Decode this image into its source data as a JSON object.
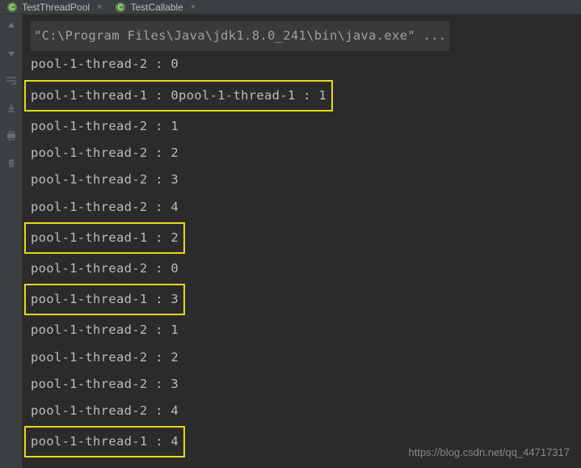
{
  "tabs": [
    {
      "label": "TestThreadPool",
      "active": false
    },
    {
      "label": "TestCallable",
      "active": true
    }
  ],
  "console": {
    "command": "\"C:\\Program Files\\Java\\jdk1.8.0_241\\bin\\java.exe\" ...",
    "lines": [
      {
        "text": "pool-1-thread-2 : 0",
        "highlighted": false
      },
      {
        "text": "pool-1-thread-1 : 0",
        "highlighted": true
      },
      {
        "text": "pool-1-thread-1 : 1",
        "highlighted": true,
        "grouped": true
      },
      {
        "text": "pool-1-thread-2 : 1",
        "highlighted": false
      },
      {
        "text": "pool-1-thread-2 : 2",
        "highlighted": false
      },
      {
        "text": "pool-1-thread-2 : 3",
        "highlighted": false
      },
      {
        "text": "pool-1-thread-2 : 4",
        "highlighted": false
      },
      {
        "text": "pool-1-thread-1 : 2",
        "highlighted": true
      },
      {
        "text": "pool-1-thread-2 : 0",
        "highlighted": false
      },
      {
        "text": "pool-1-thread-1 : 3",
        "highlighted": true
      },
      {
        "text": "pool-1-thread-2 : 1",
        "highlighted": false
      },
      {
        "text": "pool-1-thread-2 : 2",
        "highlighted": false
      },
      {
        "text": "pool-1-thread-2 : 3",
        "highlighted": false
      },
      {
        "text": "pool-1-thread-2 : 4",
        "highlighted": false
      },
      {
        "text": "pool-1-thread-1 : 4",
        "highlighted": true
      }
    ]
  },
  "watermark": "https://blog.csdn.net/qq_44717317"
}
